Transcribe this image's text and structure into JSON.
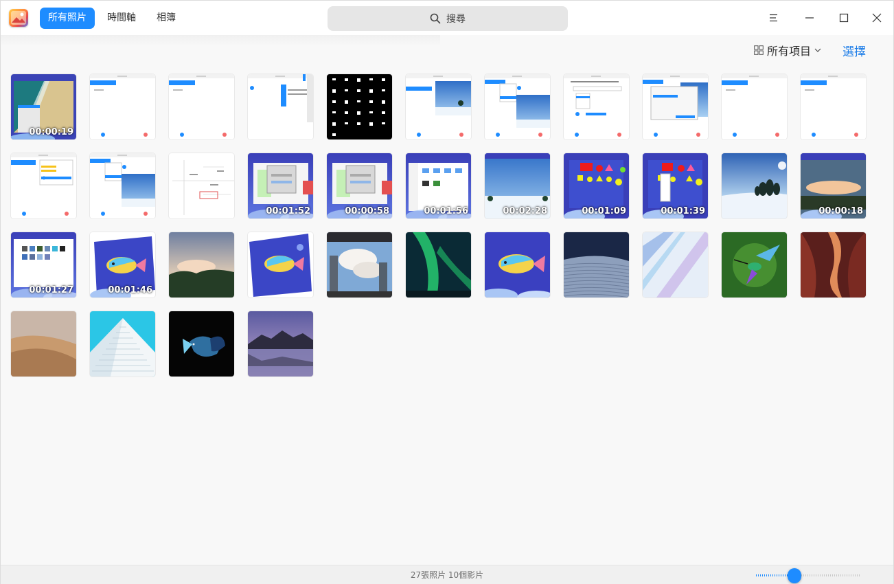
{
  "app": {
    "logo_icon": "photo-album-icon",
    "nav": [
      "所有照片",
      "時間軸",
      "相簿"
    ],
    "active_tab": 0,
    "search_placeholder": "搜尋"
  },
  "toolbar": {
    "filter_label": "所有項目",
    "select_label": "選擇"
  },
  "tiles": [
    {
      "kind": "video-beach",
      "duration": "00:00:19"
    },
    {
      "kind": "screen-list"
    },
    {
      "kind": "screen-list"
    },
    {
      "kind": "screen-menu"
    },
    {
      "kind": "black-text"
    },
    {
      "kind": "screen-snow"
    },
    {
      "kind": "screen-snow-menu"
    },
    {
      "kind": "screen-dialog"
    },
    {
      "kind": "screen-dialog-blue"
    },
    {
      "kind": "screen-list"
    },
    {
      "kind": "screen-list"
    },
    {
      "kind": "screen-yellow-menu"
    },
    {
      "kind": "screen-snow-menu"
    },
    {
      "kind": "screen-chart"
    },
    {
      "kind": "video-purple-dialog",
      "duration": "00:01:52"
    },
    {
      "kind": "video-purple-dialog",
      "duration": "00:00:58"
    },
    {
      "kind": "video-files",
      "duration": "00:01:56"
    },
    {
      "kind": "video-snow",
      "duration": "00:02:28"
    },
    {
      "kind": "video-shapes",
      "duration": "00:01:09"
    },
    {
      "kind": "video-shapes-menu",
      "duration": "00:01:39"
    },
    {
      "kind": "snow-trees"
    },
    {
      "kind": "video-sunset",
      "duration": "00:00:18"
    },
    {
      "kind": "video-gallery",
      "duration": "00:01:27"
    },
    {
      "kind": "video-fish",
      "duration": "00:01:46"
    },
    {
      "kind": "sky-trees"
    },
    {
      "kind": "fish-rotated"
    },
    {
      "kind": "city-clouds"
    },
    {
      "kind": "aurora"
    },
    {
      "kind": "fish"
    },
    {
      "kind": "dunes-night"
    },
    {
      "kind": "light-streaks"
    },
    {
      "kind": "hummingbird"
    },
    {
      "kind": "canyon"
    },
    {
      "kind": "desert"
    },
    {
      "kind": "pyramid"
    },
    {
      "kind": "betta"
    },
    {
      "kind": "mountain-lake"
    }
  ],
  "footer": {
    "count_text": "27張照片 10個影片",
    "zoom_level": 0.35
  },
  "colors": {
    "accent": "#1e8cff",
    "select_link": "#1e7ee8"
  }
}
